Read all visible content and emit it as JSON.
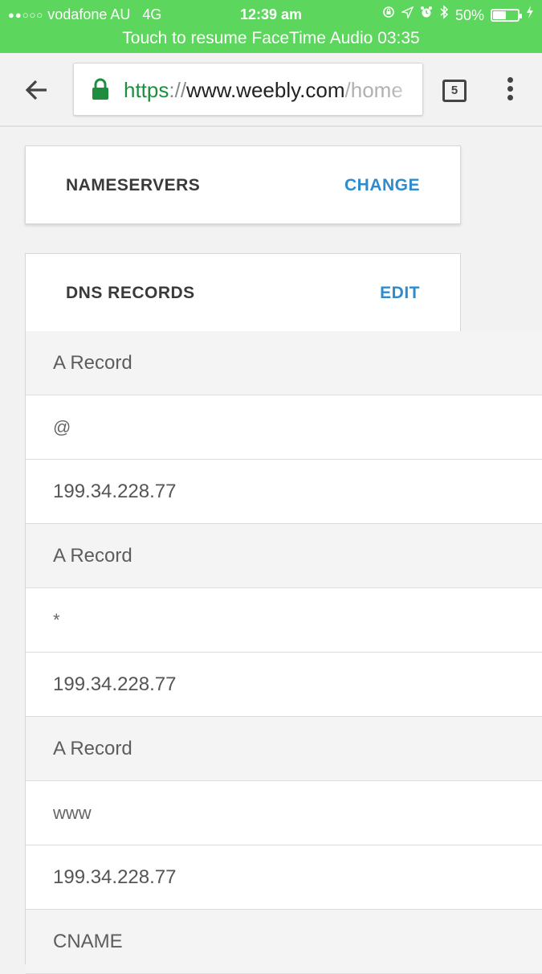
{
  "status_bar": {
    "carrier": "vodafone AU",
    "network": "4G",
    "time": "12:39 am",
    "battery": "50%",
    "battery_level": 0.5,
    "icons": [
      "orientation-lock-icon",
      "location-icon",
      "alarm-icon",
      "bluetooth-icon",
      "charging-icon"
    ],
    "banner": "Touch to resume FaceTime Audio 03:35",
    "color": "#5cd65c"
  },
  "browser": {
    "url_scheme": "https",
    "url_sep": "://",
    "url_host": "www.weebly.com",
    "url_path": "/home",
    "tab_count": "5"
  },
  "nameservers": {
    "title": "NAMESERVERS",
    "action": "CHANGE"
  },
  "dns": {
    "title": "DNS RECORDS",
    "action": "EDIT",
    "accent": "#2f8bd0",
    "records": [
      {
        "type": "A Record",
        "host": "@",
        "value": "199.34.228.77"
      },
      {
        "type": "A Record",
        "host": "*",
        "value": "199.34.228.77"
      },
      {
        "type": "A Record",
        "host": "www",
        "value": "199.34.228.77"
      },
      {
        "type": "CNAME"
      }
    ]
  }
}
